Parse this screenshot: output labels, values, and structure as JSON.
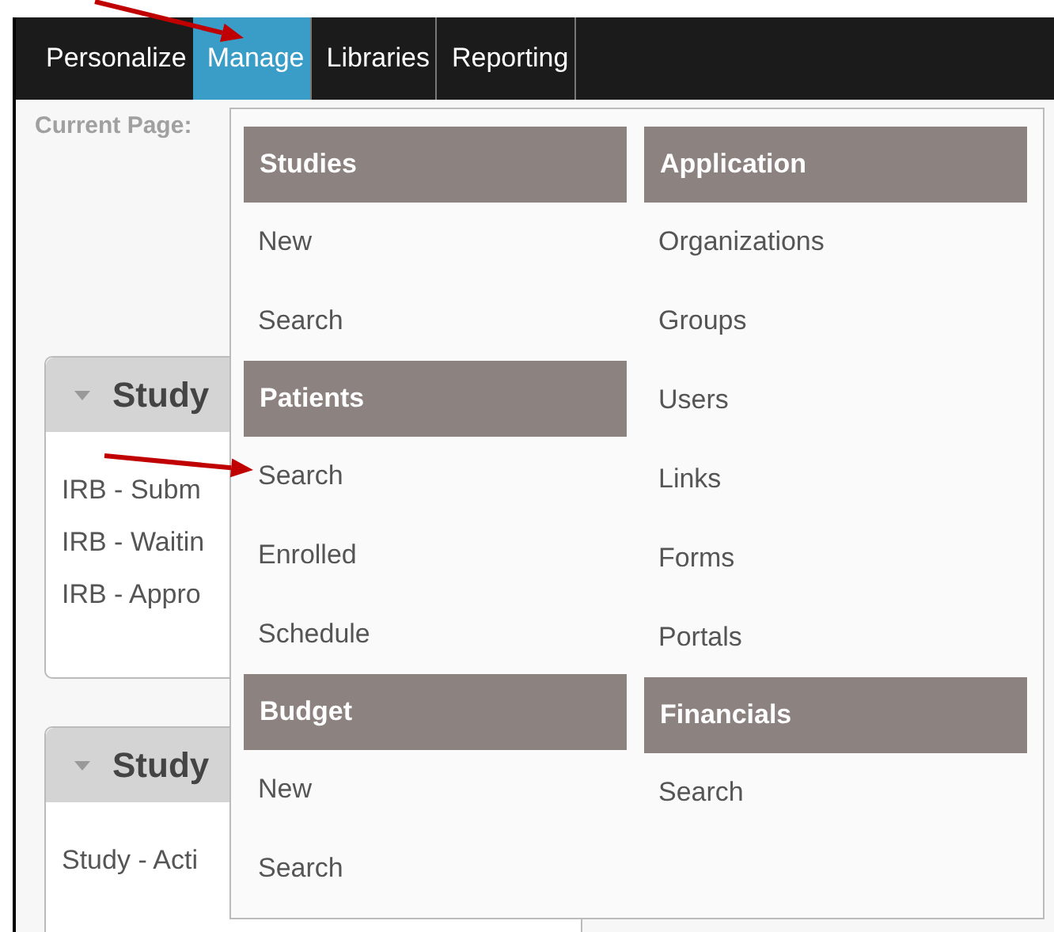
{
  "nav": {
    "tabs": [
      {
        "label": "Personalize",
        "selected": false
      },
      {
        "label": "Manage",
        "selected": true
      },
      {
        "label": "Libraries",
        "selected": false
      },
      {
        "label": "Reporting",
        "selected": false
      }
    ]
  },
  "current_page_label": "Current Page:",
  "panels": [
    {
      "title": "Study",
      "items": [
        "IRB - Subm",
        "IRB - Waitin",
        "IRB - Appro"
      ]
    },
    {
      "title": "Study",
      "items": [
        "Study - Acti"
      ]
    }
  ],
  "dropdown": {
    "columns": [
      {
        "entries": [
          {
            "kind": "header",
            "label": "Studies"
          },
          {
            "kind": "item",
            "label": "New"
          },
          {
            "kind": "item",
            "label": "Search"
          },
          {
            "kind": "header",
            "label": "Patients"
          },
          {
            "kind": "item",
            "label": "Search"
          },
          {
            "kind": "item",
            "label": "Enrolled"
          },
          {
            "kind": "item",
            "label": "Schedule"
          },
          {
            "kind": "header",
            "label": "Budget"
          },
          {
            "kind": "item",
            "label": "New"
          },
          {
            "kind": "item",
            "label": "Search"
          }
        ]
      },
      {
        "entries": [
          {
            "kind": "header",
            "label": "Application"
          },
          {
            "kind": "item",
            "label": "Organizations"
          },
          {
            "kind": "item",
            "label": "Groups"
          },
          {
            "kind": "item",
            "label": "Users"
          },
          {
            "kind": "item",
            "label": "Links"
          },
          {
            "kind": "item",
            "label": "Forms"
          },
          {
            "kind": "item",
            "label": "Portals"
          },
          {
            "kind": "header",
            "label": "Financials"
          },
          {
            "kind": "item",
            "label": "Search"
          }
        ]
      }
    ]
  }
}
